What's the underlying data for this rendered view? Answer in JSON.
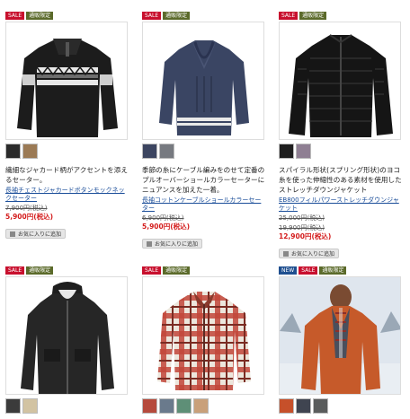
{
  "products": [
    {
      "badges": [
        "SALE",
        "通販限定"
      ],
      "description": "繊細なジャカード柄がアクセントを添えるセーター。",
      "name": "長袖チェストジャカードボタンモックネックセーター",
      "old_price": "7,900円(税込)",
      "price": "5,900円(税込)",
      "swatch_colors": [
        "#2b2b2b",
        "#9b7a55"
      ],
      "fav_label": "お気に入りに追加"
    },
    {
      "badges": [
        "SALE",
        "通販限定"
      ],
      "description": "季節の糸にケーブル編みをのせて定番のプルオーバーショールカラーセーターにニュアンスを加えた一着。",
      "name": "長袖コットンケーブルショールカラーセーター",
      "old_price": "6,900円(税込)",
      "price": "5,900円(税込)",
      "swatch_colors": [
        "#3c4560",
        "#777a80"
      ],
      "fav_label": "お気に入りに追加"
    },
    {
      "badges": [
        "SALE",
        "通販限定"
      ],
      "description": "スパイラル形状(スプリング形状)のヨコ糸を使った伸縮性のある素材を使用したストレッチダウンジャケット",
      "name": "EB800フィルパワーストレッチダウンジャケット",
      "old_price_1": "25,000円(税込)",
      "old_price_2": "19,900円(税込)",
      "price": "12,900円(税込)",
      "swatch_colors": [
        "#1e1e1e",
        "#8f7f93"
      ],
      "fav_label": "お気に入りに追加"
    },
    {
      "badges": [
        "SALE",
        "通販限定"
      ],
      "swatch_colors": [
        "#3b3b3b",
        "#d2c3a2"
      ]
    },
    {
      "badges": [
        "SALE",
        "通販限定"
      ],
      "swatch_colors": [
        "#b64a3c",
        "#6a7a8c",
        "#5e8f77",
        "#c9a07a"
      ]
    },
    {
      "badges": [
        "NEW",
        "SALE",
        "通販限定"
      ],
      "swatch_colors": [
        "#c6502a",
        "#3f4450",
        "#5a5c5c"
      ]
    }
  ]
}
